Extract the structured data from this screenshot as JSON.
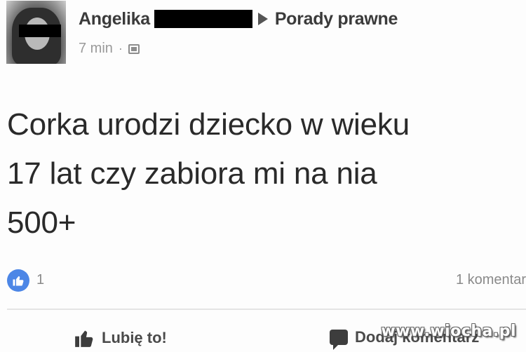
{
  "post": {
    "author_name": "Angelika",
    "group_name": "Porady prawne",
    "timestamp": "7 min",
    "meta_separator": "·",
    "privacy_icon": "group-icon",
    "text_lines": [
      "Corka urodzi dziecko w wieku",
      "17 lat czy zabiora mi na nia",
      "500+"
    ]
  },
  "reactions": {
    "like_count": "1",
    "comments_label": "1 komentar"
  },
  "actions": {
    "like_label": "Lubię to!",
    "comment_label": "Dodaj komentarz"
  },
  "watermark": "www.wiocha.pl",
  "colors": {
    "like_badge": "#4c86e6",
    "text": "#2a2a2a",
    "meta": "#9a9a9a"
  }
}
